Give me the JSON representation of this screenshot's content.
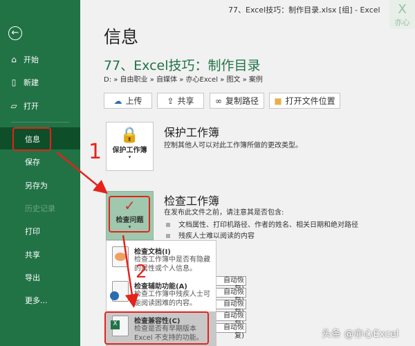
{
  "window_title": "77、Excel技巧：制作目录.xlsx [组] - Excel",
  "logo": {
    "letter": "X",
    "caption": "亦心"
  },
  "sidebar": {
    "top_items": [
      {
        "icon": "home-icon",
        "label": "开始"
      },
      {
        "icon": "new-file-icon",
        "label": "新建"
      },
      {
        "icon": "open-folder-icon",
        "label": "打开"
      }
    ],
    "items": [
      {
        "label": "信息",
        "selected": true
      },
      {
        "label": "保存"
      },
      {
        "label": "另存为"
      },
      {
        "label": "历史记录",
        "disabled": true
      },
      {
        "label": "打印"
      },
      {
        "label": "共享"
      },
      {
        "label": "导出"
      },
      {
        "label": "更多..."
      }
    ]
  },
  "main": {
    "title": "信息",
    "file_name": "77、Excel技巧：制作目录",
    "path": "D: » 自由职业 » 自媒体 » 亦心Excel » 图文 » 案例",
    "buttons": [
      {
        "icon": "upload-cloud-icon",
        "label": "上传"
      },
      {
        "icon": "share-icon",
        "label": "共享"
      },
      {
        "icon": "link-icon",
        "label": "复制路径"
      },
      {
        "icon": "folder-icon",
        "label": "打开文件位置"
      }
    ],
    "protect": {
      "button": "保护工作簿",
      "title": "保护工作簿",
      "desc": "控制其他人可以对此工作簿所做的更改类型。"
    },
    "inspect": {
      "button": "检查问题",
      "title": "检查工作簿",
      "desc": "在发布此文件之前，请注意其是否包含:",
      "bullets": [
        "文档属性、打印机路径、作者的姓名、相关日期和绝对路径",
        "残疾人士难以阅读的内容"
      ]
    },
    "menu": [
      {
        "title": "检查文档(I)",
        "desc": "检查工作簿中是否有隐藏的属性或个人信息。"
      },
      {
        "title": "检查辅助功能(A)",
        "desc": "检查工作簿中残疾人士可能阅读困难的内容。"
      },
      {
        "title": "检查兼容性(C)",
        "desc": "检查是否有早期版本 Excel 不支持的功能。",
        "highlighted": true
      }
    ],
    "autorecover": [
      "自动恢复)",
      "自动恢复)",
      "自动恢复)",
      "自动恢复)",
      "自动恢复)"
    ]
  },
  "annotations": {
    "step1": "1",
    "step2": "2",
    "accent": "#e5221b"
  },
  "watermark": "头条 @亦心Excel"
}
